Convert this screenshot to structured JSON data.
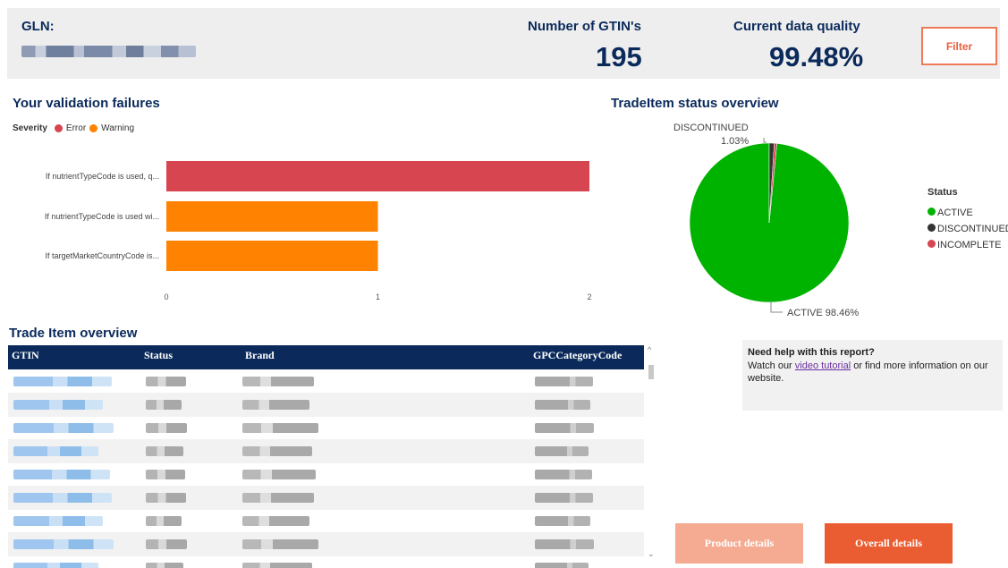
{
  "header": {
    "gln_label": "GLN:",
    "gtin_label": "Number of GTIN's",
    "gtin_value": "195",
    "quality_label": "Current data quality",
    "quality_value": "99.48%",
    "filter_label": "Filter"
  },
  "validation": {
    "title": "Your validation failures",
    "legend_title": "Severity",
    "legend": [
      {
        "name": "Error",
        "color": "#d64550"
      },
      {
        "name": "Warning",
        "color": "#ff8200"
      }
    ]
  },
  "status_overview": {
    "title": "TradeItem status overview",
    "legend_title": "Status",
    "legend": [
      {
        "name": "ACTIVE",
        "color": "#00b300"
      },
      {
        "name": "DISCONTINUED",
        "color": "#333333"
      },
      {
        "name": "INCOMPLETE",
        "color": "#d64550"
      }
    ],
    "label_discontinued": "DISCONTINUED",
    "label_discontinued_pct": "1.03%",
    "label_active": "ACTIVE 98.46%"
  },
  "chart_data": [
    {
      "type": "bar",
      "orientation": "horizontal",
      "categories": [
        "If nutrientTypeCode is used, q...",
        "If nutrientTypeCode is used wi...",
        "If targetMarketCountryCode is..."
      ],
      "values": [
        2,
        1,
        1
      ],
      "severity": [
        "Error",
        "Warning",
        "Warning"
      ],
      "colors": [
        "#d64550",
        "#ff8200",
        "#ff8200"
      ],
      "xlim": [
        0,
        2
      ],
      "xticks": [
        "0",
        "1",
        "2"
      ]
    },
    {
      "type": "pie",
      "labels": [
        "ACTIVE",
        "DISCONTINUED",
        "INCOMPLETE"
      ],
      "values": [
        98.46,
        1.03,
        0.51
      ],
      "colors": [
        "#00b300",
        "#333333",
        "#d64550"
      ]
    }
  ],
  "trade_items": {
    "title": "Trade Item overview",
    "columns": [
      "GTIN",
      "Status",
      "Brand",
      "GPCCategoryCode"
    ],
    "row_count": 9
  },
  "help": {
    "title": "Need help with this report?",
    "text_before": "Watch our ",
    "link": "video tutorial",
    "text_after": " or find more information on our website."
  },
  "buttons": {
    "product_details": "Product details",
    "overall_details": "Overall details"
  }
}
